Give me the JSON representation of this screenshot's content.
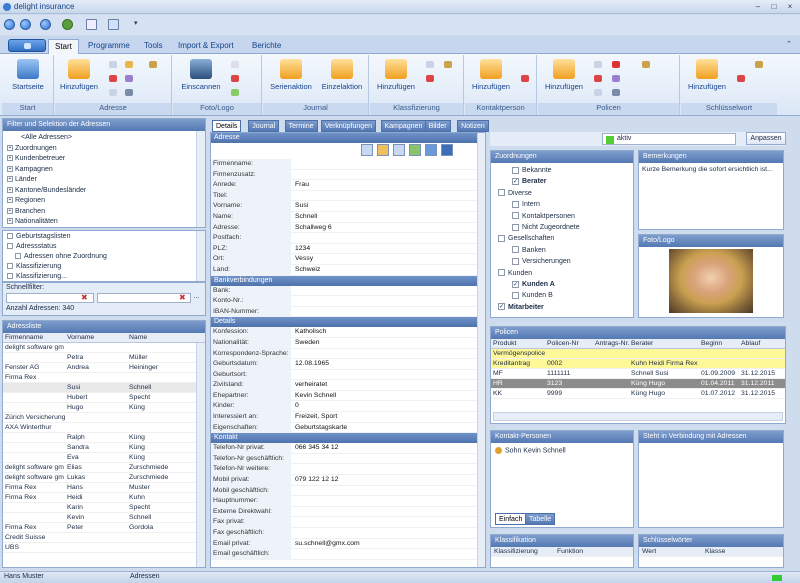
{
  "app": {
    "title": "delight insurance"
  },
  "ribbon": {
    "tabs": [
      "Start",
      "Programme",
      "Tools",
      "Import & Export",
      "Berichte"
    ],
    "groups": [
      {
        "label": "Start",
        "buttons": [
          "Startseite"
        ]
      },
      {
        "label": "Adresse",
        "buttons": [
          "Hinzufügen"
        ]
      },
      {
        "label": "Foto/Logo",
        "buttons": [
          "Einscannen"
        ]
      },
      {
        "label": "Journal",
        "buttons": [
          "Serienaktion",
          "Einzelaktion"
        ]
      },
      {
        "label": "Klassfizierung",
        "buttons": [
          "Hinzufügen"
        ]
      },
      {
        "label": "Kontaktperson",
        "buttons": [
          "Hinzufügen"
        ]
      },
      {
        "label": "Policen",
        "buttons": [
          "Hinzufügen"
        ]
      },
      {
        "label": "Schlüsselwort",
        "buttons": [
          "Hinzufügen"
        ]
      }
    ]
  },
  "filter": {
    "header": "Filter und Selektion der Adressen",
    "tree": [
      "<Alle Adressen>",
      "Zuordnungen",
      "Kundenbetreuer",
      "Kampagnen",
      "Länder",
      "Kantone/Bundesländer",
      "Regionen",
      "Branchen",
      "Nationalitäten"
    ],
    "list2": [
      "Geburtstagslisten",
      "Adressstatus",
      "Adressen ohne Zuordnung",
      "Klassifizierung",
      "Klassifizierung..."
    ],
    "schnellfilter_label": "Schnellfilter:",
    "count_label": "Anzahl Adressen: 340"
  },
  "addresslist": {
    "header": "Adressliste",
    "columns": [
      "Firmenname",
      "Vorname",
      "Name"
    ],
    "rows": [
      [
        "delight software gm",
        "",
        ""
      ],
      [
        "",
        "Petra",
        "Müller"
      ],
      [
        "Fenster AG",
        "Andrea",
        "Heininger"
      ],
      [
        "Firma Rex",
        "",
        ""
      ],
      [
        "",
        "Susi",
        "Schnell"
      ],
      [
        "",
        "Hubert",
        "Specht"
      ],
      [
        "",
        "Hugo",
        "Küng"
      ],
      [
        "Zürich Versicherung",
        "",
        ""
      ],
      [
        "AXA Winterthur",
        "",
        ""
      ],
      [
        "",
        "Ralph",
        "Küng"
      ],
      [
        "",
        "Sandra",
        "Küng"
      ],
      [
        "",
        "Eva",
        "Küng"
      ],
      [
        "delight software gm",
        "Elias",
        "Zurschmiede"
      ],
      [
        "delight software gm",
        "Lukas",
        "Zurschmiede"
      ],
      [
        "Firma Rex",
        "Hans",
        "Muster"
      ],
      [
        "Firma Rex",
        "Heidi",
        "Kuhn"
      ],
      [
        "",
        "Karin",
        "Specht"
      ],
      [
        "",
        "Kevin",
        "Schnell"
      ],
      [
        "Firma Rex",
        "Peter",
        "Gordola"
      ],
      [
        "Credit Suisse",
        "",
        ""
      ],
      [
        "UBS",
        "",
        ""
      ]
    ],
    "selected_index": 4
  },
  "details": {
    "tabs": [
      "Details",
      "Journal",
      "Termine",
      "Verknüpfungen",
      "Kampagnen",
      "Bilder",
      "Notizen"
    ],
    "sections": [
      {
        "title": "Adresse",
        "rows": [
          [
            "Firmenname:",
            ""
          ],
          [
            "Firmenzusatz:",
            ""
          ],
          [
            "Anrede:",
            "Frau"
          ],
          [
            "Titel:",
            ""
          ],
          [
            "Vorname:",
            "Susi"
          ],
          [
            "Name:",
            "Schnell"
          ],
          [
            "Adresse:",
            "Schallweg 6"
          ],
          [
            "Postfach:",
            ""
          ],
          [
            "PLZ:",
            "1234"
          ],
          [
            "Ort:",
            "Vessy"
          ],
          [
            "Land:",
            "Schweiz"
          ]
        ]
      },
      {
        "title": "Bankverbindungen",
        "rows": [
          [
            "Bank:",
            ""
          ],
          [
            "Konto-Nr.:",
            ""
          ],
          [
            "IBAN-Nummer:",
            ""
          ]
        ]
      },
      {
        "title": "Details",
        "rows": [
          [
            "Konfession:",
            "Katholisch"
          ],
          [
            "Nationalität:",
            "Sweden"
          ],
          [
            "Korrespondenz-Sprache:",
            ""
          ],
          [
            "Geburtsdatum:",
            "12.08.1965"
          ],
          [
            "Geburtsort:",
            ""
          ],
          [
            "Zivilstand:",
            "verheiratet"
          ],
          [
            "Ehepartner:",
            "Kevin Schnell"
          ],
          [
            "Kinder:",
            "0"
          ],
          [
            "Interessiert an:",
            "Freizeit, Sport"
          ],
          [
            "Eigenschaften:",
            "Geburtstagskarte"
          ]
        ]
      },
      {
        "title": "Kontakt",
        "rows": [
          [
            "Telefon-Nr privat:",
            "066 345 34 12"
          ],
          [
            "Telefon-Nr geschäftlich:",
            ""
          ],
          [
            "Telefon-Nr weitere:",
            ""
          ],
          [
            "Mobil privat:",
            "079 122 12 12"
          ],
          [
            "Mobil geschäftlich:",
            ""
          ],
          [
            "Hauptnummer:",
            ""
          ],
          [
            "Externe Direktwahl:",
            ""
          ],
          [
            "Fax privat:",
            ""
          ],
          [
            "Fax geschäftlich:",
            ""
          ],
          [
            "Email privat:",
            "su.schnell@gmx.com"
          ],
          [
            "Email geschäftlich:",
            ""
          ]
        ]
      }
    ]
  },
  "right": {
    "status_label": "aktiv",
    "status_color": "#55cc33",
    "anpassen_label": "Anpassen",
    "zuordnungen": {
      "header": "Zuordnungen",
      "items": [
        {
          "label": "Bekannte",
          "checked": false,
          "bold": false,
          "level": 1
        },
        {
          "label": "Berater",
          "checked": true,
          "bold": true,
          "level": 1
        },
        {
          "label": "Diverse",
          "checked": false,
          "bold": false,
          "level": 0
        },
        {
          "label": "Intern",
          "checked": false,
          "bold": false,
          "level": 1
        },
        {
          "label": "Kontaktpersonen",
          "checked": false,
          "bold": false,
          "level": 1
        },
        {
          "label": "Nicht Zugeordnete",
          "checked": false,
          "bold": false,
          "level": 1
        },
        {
          "label": "Gesellschaften",
          "checked": false,
          "bold": false,
          "level": 0
        },
        {
          "label": "Banken",
          "checked": false,
          "bold": false,
          "level": 1
        },
        {
          "label": "Versicherungen",
          "checked": false,
          "bold": false,
          "level": 1
        },
        {
          "label": "Kunden",
          "checked": false,
          "bold": false,
          "level": 0
        },
        {
          "label": "Kunden A",
          "checked": true,
          "bold": true,
          "level": 1
        },
        {
          "label": "Kunden B",
          "checked": false,
          "bold": false,
          "level": 1
        },
        {
          "label": "Mitarbeiter",
          "checked": true,
          "bold": true,
          "level": 0
        }
      ]
    },
    "bemerkungen": {
      "header": "Bemerkungen",
      "text": "Kurze Bemerkung die sofort ersichtlich ist..."
    },
    "foto": {
      "header": "Foto/Logo"
    },
    "policen": {
      "header": "Policen",
      "columns": [
        "Produkt",
        "Policen-Nr",
        "Antrags-Nr.",
        "Berater",
        "Beginn",
        "Ablauf"
      ],
      "rows": [
        [
          "Vermögenspolice",
          "",
          "",
          "",
          "",
          ""
        ],
        [
          "Kreditantrag",
          "0002",
          "",
          "Kuhn Heidi Firma Rex",
          "",
          ""
        ],
        [
          "MF",
          "1111111",
          "",
          "Schnell Susi",
          "01.09.2009",
          "31.12.2015"
        ],
        [
          "HR",
          "3123",
          "",
          "Küng Hugo",
          "01.04.2011",
          "31.12.2011"
        ],
        [
          "KK",
          "9999",
          "",
          "Küng Hugo",
          "01.07.2012",
          "31.12.2015"
        ]
      ]
    },
    "kontakt": {
      "header": "Kontakt-Personen",
      "person": "Sohn Kevin Schnell",
      "tabs": [
        "Einfach",
        "Tabelle"
      ]
    },
    "verbindung": {
      "header": "Steht in Verbindung mit Adressen"
    },
    "klassifikation": {
      "header": "Klassifikation",
      "columns": [
        "Klassifizierung",
        "Funktion"
      ]
    },
    "schluessel": {
      "header": "Schlüsselwörter",
      "columns": [
        "Wert",
        "Klasse"
      ]
    }
  },
  "statusbar": {
    "user": "Hans Muster",
    "module": "Adressen"
  }
}
